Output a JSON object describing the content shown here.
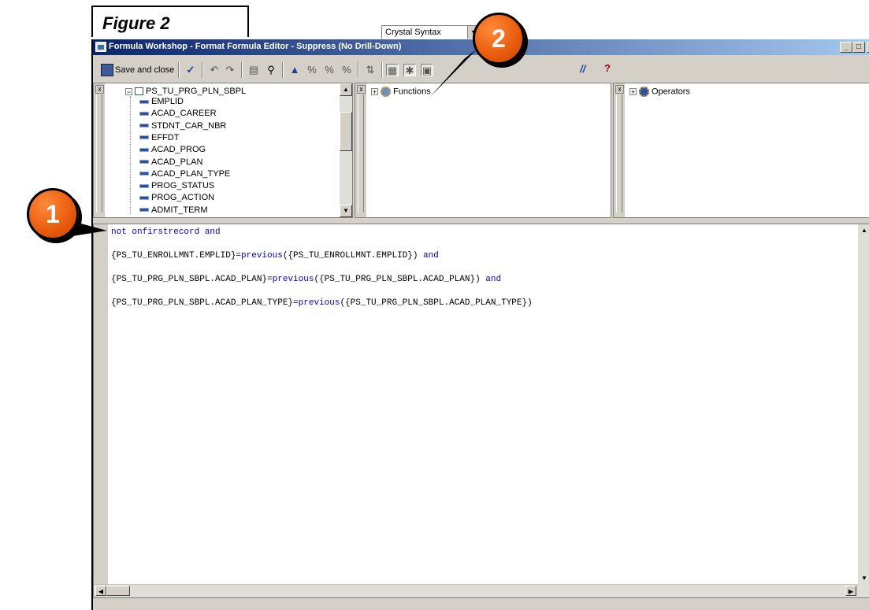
{
  "figure_label": "Figure 2",
  "window": {
    "title": "Formula Workshop - Format Formula Editor - Suppress (No Drill-Down)",
    "buttons": {
      "minimize": "_",
      "maximize": "□",
      "close": "×"
    }
  },
  "toolbar": {
    "save_label": "Save and close",
    "syntax_select": "Crystal Syntax",
    "comment_label": "//",
    "help_label": "?"
  },
  "fields_pane": {
    "table_name": "PS_TU_PRG_PLN_SBPL",
    "fields": [
      "EMPLID",
      "ACAD_CAREER",
      "STDNT_CAR_NBR",
      "EFFDT",
      "ACAD_PROG",
      "ACAD_PLAN",
      "ACAD_PLAN_TYPE",
      "PROG_STATUS",
      "PROG_ACTION",
      "ADMIT_TERM"
    ]
  },
  "functions_pane": {
    "label": "Functions"
  },
  "operators_pane": {
    "label": "Operators"
  },
  "editor": {
    "lines": [
      {
        "parts": [
          {
            "t": "not onfirstrecord and",
            "kw": true
          }
        ]
      },
      {
        "parts": [
          {
            "t": "{PS_TU_ENROLLMNT.EMPLID}=",
            "kw": false
          },
          {
            "t": "previous",
            "kw": true
          },
          {
            "t": "({PS_TU_ENROLLMNT.EMPLID}) ",
            "kw": false
          },
          {
            "t": "and",
            "kw": true
          }
        ]
      },
      {
        "parts": [
          {
            "t": "{PS_TU_PRG_PLN_SBPL.ACAD_PLAN}=",
            "kw": false
          },
          {
            "t": "previous",
            "kw": true
          },
          {
            "t": "({PS_TU_PRG_PLN_SBPL.ACAD_PLAN}) ",
            "kw": false
          },
          {
            "t": "and",
            "kw": true
          }
        ]
      },
      {
        "parts": [
          {
            "t": "{PS_TU_PRG_PLN_SBPL.ACAD_PLAN_TYPE}=",
            "kw": false
          },
          {
            "t": "previous",
            "kw": true
          },
          {
            "t": "({PS_TU_PRG_PLN_SBPL.ACAD_PLAN_TYPE})",
            "kw": false
          }
        ]
      }
    ]
  },
  "callouts": [
    "1",
    "2"
  ],
  "colors": {
    "keyword": "#0000cc",
    "callout": "#e85a0c",
    "titlebar": "#0a246a"
  }
}
